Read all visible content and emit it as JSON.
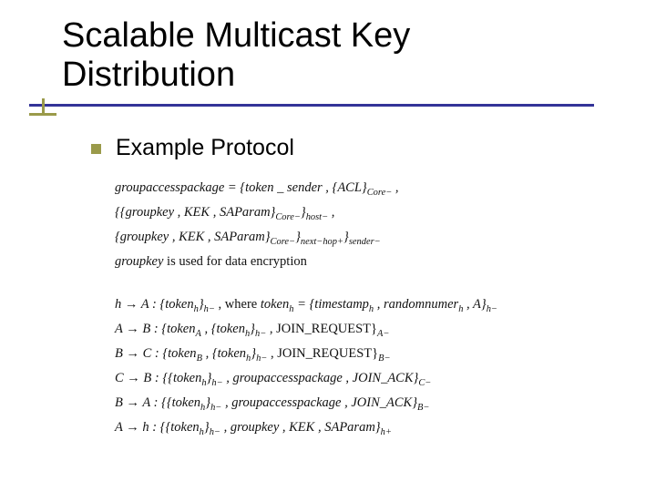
{
  "title": {
    "line1": "Scalable Multicast Key",
    "line2": "Distribution"
  },
  "bullet": {
    "label": "Example Protocol"
  },
  "formulas": {
    "gap1": "groupaccesspackage = {token _ sender , {ACL}",
    "gap1_sub": "Core−",
    "gap1_tail": " ,",
    "gap2_a": "{{groupkey , KEK , SAParam}",
    "gap2_a_sub": "Core−",
    "gap2_b": "}",
    "gap2_b_sub": "host−",
    "gap2_tail": " ,",
    "gap3_a": "{groupkey , KEK , SAParam}",
    "gap3_a_sub": "Core−",
    "gap3_b": "}",
    "gap3_b_sub": "next−hop+",
    "gap3_c": "}",
    "gap3_c_sub": "sender−",
    "gap4_a": "groupkey",
    "gap4_b": " is used for data encryption",
    "step1_a": "h → A : {token",
    "step1_a_sub": "h",
    "step1_b": "}",
    "step1_b_sub": "h−",
    "step1_c": " , where ",
    "step1_d": "token",
    "step1_d_sub": "h",
    "step1_e": " = {timestamp",
    "step1_e_sub": "h",
    "step1_f": " , randomnumer",
    "step1_f_sub": "h",
    "step1_g": " , A}",
    "step1_g_sub": "h−",
    "step2_a": "A → B : {token",
    "step2_a_sub": "A",
    "step2_b": " , {token",
    "step2_b_sub": "h",
    "step2_c": "}",
    "step2_c_sub": "h−",
    "step2_d": " , JOIN_REQUEST}",
    "step2_d_sub": "A−",
    "step3_a": "B → C : {token",
    "step3_a_sub": "B",
    "step3_b": " , {token",
    "step3_b_sub": "h",
    "step3_c": "}",
    "step3_c_sub": "h−",
    "step3_d": " , JOIN_REQUEST}",
    "step3_d_sub": "B−",
    "step4_a": "C → B : {{token",
    "step4_a_sub": "h",
    "step4_b": "}",
    "step4_b_sub": "h−",
    "step4_c": " , groupaccesspackage , JOIN_ACK}",
    "step4_c_sub": "C−",
    "step5_a": "B → A : {{token",
    "step5_a_sub": "h",
    "step5_b": "}",
    "step5_b_sub": "h−",
    "step5_c": " , groupaccesspackage , JOIN_ACK}",
    "step5_c_sub": "B−",
    "step6_a": "A → h : {{token",
    "step6_a_sub": "h",
    "step6_b": "}",
    "step6_b_sub": "h−",
    "step6_c": " , groupkey , KEK , SAParam}",
    "step6_c_sub": "h+"
  }
}
